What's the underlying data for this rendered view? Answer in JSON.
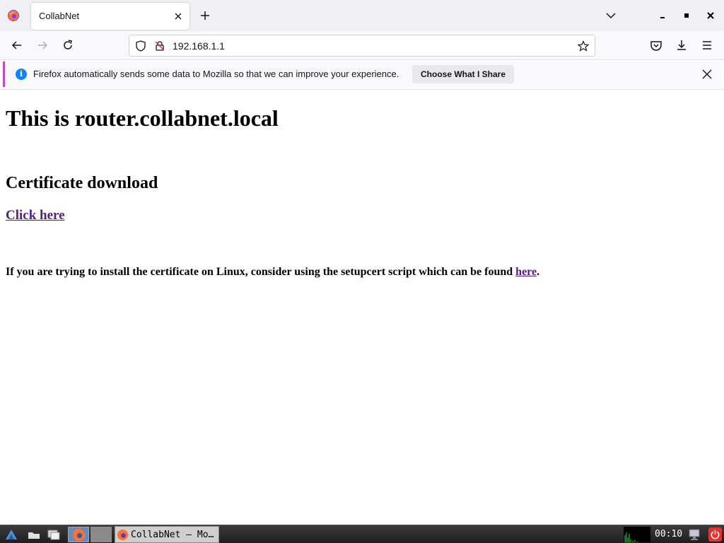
{
  "browser": {
    "tab_title": "CollabNet",
    "url": "192.168.1.1"
  },
  "notification": {
    "message": "Firefox automatically sends some data to Mozilla so that we can improve your experience.",
    "button_label": "Choose What I Share"
  },
  "page": {
    "heading": "This is router.collabnet.local",
    "subheading": "Certificate download",
    "download_link": "Click here",
    "linux_note_prefix": "If you are trying to install the certificate on Linux, consider using the setupcert script which can be found ",
    "linux_note_link": "here",
    "linux_note_suffix": "."
  },
  "taskbar": {
    "window_label": "CollabNet — Mo…",
    "clock": "00:10"
  },
  "colors": {
    "accent": "#0a84ff",
    "visited_link": "#551a8b",
    "notification_stripe": "#c04ac0"
  }
}
